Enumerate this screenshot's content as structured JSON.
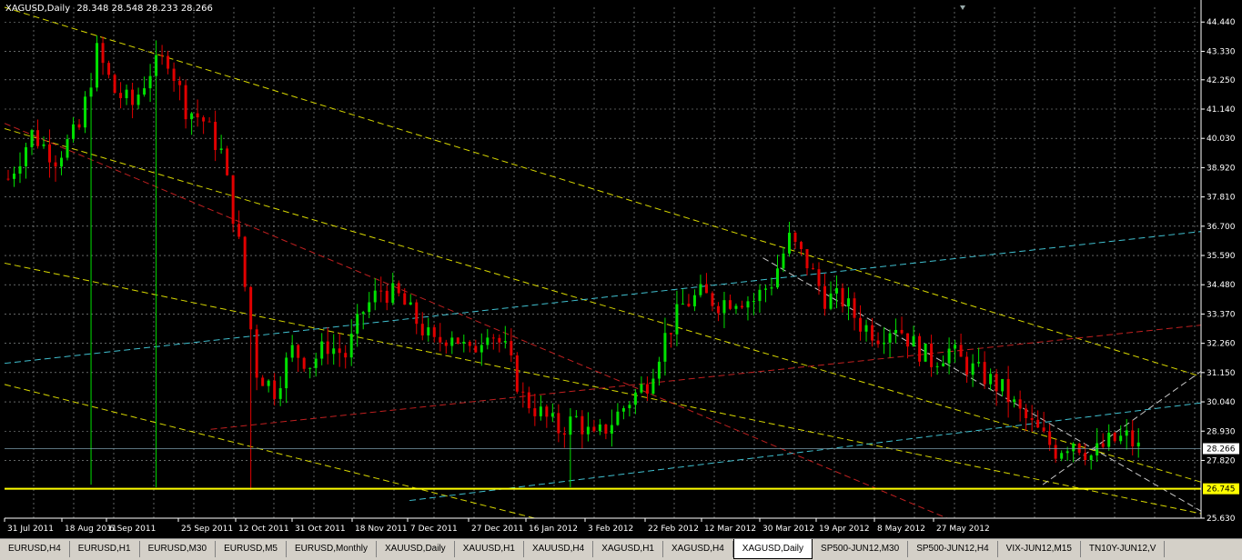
{
  "window": {
    "title_symbol": "XAGUSD,Daily",
    "ohlc": "28.348 28.548 28.233 28.266"
  },
  "colors": {
    "bull": "#00e000",
    "bear": "#e00000",
    "grid": "#9ea4a4",
    "trend_yellow": "#d8d800",
    "trend_cyan": "#40c0d0",
    "trend_red": "#c02020",
    "trend_white": "#c8c8c8",
    "hline": "#ffff00"
  },
  "chart_data": {
    "type": "candlestick",
    "symbol": "XAGUSD",
    "timeframe": "Daily",
    "ylim": [
      25.63,
      45.0
    ],
    "y_ticks": [
      "44.440",
      "43.330",
      "42.250",
      "41.140",
      "40.030",
      "38.920",
      "37.810",
      "36.700",
      "35.590",
      "34.480",
      "33.370",
      "32.260",
      "31.150",
      "30.040",
      "28.930",
      "27.820",
      "26.745",
      "25.630"
    ],
    "x_ticks": [
      "31 Jul 2011",
      "18 Aug 2011",
      "6 Sep 2011",
      "25 Sep 2011",
      "12 Oct 2011",
      "31 Oct 2011",
      "18 Nov 2011",
      "7 Dec 2011",
      "27 Dec 2011",
      "16 Jan 2012",
      "3 Feb 2012",
      "22 Feb 2012",
      "12 Mar 2012",
      "30 Mar 2012",
      "19 Apr 2012",
      "8 May 2012",
      "27 May 2012"
    ],
    "current_price": "28.266",
    "hline_price": "26.745",
    "grid": true,
    "price_path": [
      [
        0,
        38.5
      ],
      [
        4,
        40.2
      ],
      [
        8,
        39.3
      ],
      [
        12,
        40.4
      ],
      [
        15,
        43.3
      ],
      [
        18,
        41.8
      ],
      [
        21,
        41.3
      ],
      [
        24,
        42.6
      ],
      [
        27,
        43.1
      ],
      [
        30,
        41.2
      ],
      [
        33,
        40.7
      ],
      [
        36,
        39.5
      ],
      [
        39,
        36.0
      ],
      [
        42,
        31.2
      ],
      [
        45,
        30.5
      ],
      [
        48,
        32.0
      ],
      [
        51,
        31.5
      ],
      [
        54,
        32.2
      ],
      [
        57,
        31.8
      ],
      [
        60,
        33.5
      ],
      [
        63,
        34.3
      ],
      [
        66,
        34.0
      ],
      [
        69,
        33.1
      ],
      [
        72,
        32.2
      ],
      [
        75,
        32.7
      ],
      [
        78,
        31.8
      ],
      [
        81,
        32.9
      ],
      [
        84,
        32.0
      ],
      [
        87,
        30.2
      ],
      [
        90,
        29.6
      ],
      [
        93,
        29.0
      ],
      [
        96,
        29.4
      ],
      [
        99,
        28.6
      ],
      [
        102,
        29.3
      ],
      [
        105,
        30.1
      ],
      [
        108,
        30.8
      ],
      [
        111,
        32.5
      ],
      [
        114,
        33.7
      ],
      [
        117,
        34.1
      ],
      [
        120,
        33.8
      ],
      [
        123,
        34.0
      ],
      [
        126,
        33.9
      ],
      [
        129,
        34.6
      ],
      [
        132,
        36.2
      ],
      [
        135,
        35.3
      ],
      [
        138,
        34.0
      ],
      [
        141,
        33.9
      ],
      [
        144,
        33.0
      ],
      [
        147,
        32.6
      ],
      [
        150,
        33.0
      ],
      [
        153,
        32.2
      ],
      [
        156,
        31.6
      ],
      [
        159,
        32.0
      ],
      [
        162,
        31.4
      ],
      [
        165,
        31.0
      ],
      [
        168,
        30.5
      ],
      [
        171,
        29.6
      ],
      [
        174,
        28.9
      ],
      [
        177,
        28.2
      ],
      [
        180,
        28.6
      ],
      [
        183,
        28.0
      ],
      [
        186,
        28.5
      ],
      [
        189,
        28.7
      ],
      [
        191,
        28.27
      ]
    ],
    "spikes": [
      {
        "i": 14,
        "value": 26.9
      },
      {
        "i": 25,
        "value": 26.8
      },
      {
        "i": 41,
        "value": 26.7
      },
      {
        "i": 95,
        "value": 26.8
      }
    ],
    "trendlines": [
      {
        "color": "yellow",
        "p1": [
          "2011-07-31",
          45.0
        ],
        "p2": [
          "2012-06-20",
          31.0
        ]
      },
      {
        "color": "yellow",
        "p1": [
          "2011-07-31",
          40.4
        ],
        "p2": [
          "2012-06-20",
          27.0
        ]
      },
      {
        "color": "yellow",
        "p1": [
          "2011-07-31",
          35.3
        ],
        "p2": [
          "2012-06-20",
          25.8
        ]
      },
      {
        "color": "yellow",
        "p1": [
          "2011-07-31",
          30.7
        ],
        "p2": [
          "2011-12-22",
          25.63
        ]
      },
      {
        "color": "red",
        "p1": [
          "2011-07-31",
          40.6
        ],
        "p2": [
          "2012-04-12",
          25.63
        ]
      },
      {
        "color": "red",
        "p1": [
          "2011-09-25",
          29.0
        ],
        "p2": [
          "2012-06-20",
          32.95
        ]
      },
      {
        "color": "cyan",
        "p1": [
          "2011-07-31",
          31.5
        ],
        "p2": [
          "2012-06-20",
          36.5
        ]
      },
      {
        "color": "cyan",
        "p1": [
          "2011-11-18",
          26.3
        ],
        "p2": [
          "2012-06-20",
          30.0
        ]
      },
      {
        "color": "white",
        "p1": [
          "2012-02-22",
          35.5
        ],
        "p2": [
          "2012-06-20",
          25.9
        ]
      },
      {
        "color": "white",
        "p1": [
          "2012-05-08",
          26.9
        ],
        "p2": [
          "2012-06-20",
          31.2
        ]
      }
    ]
  },
  "tabs": [
    {
      "label": "EURUSD,H4",
      "active": false
    },
    {
      "label": "EURUSD,H1",
      "active": false
    },
    {
      "label": "EURUSD,M30",
      "active": false
    },
    {
      "label": "EURUSD,M5",
      "active": false
    },
    {
      "label": "EURUSD,Monthly",
      "active": false
    },
    {
      "label": "XAUUSD,Daily",
      "active": false
    },
    {
      "label": "XAUUSD,H1",
      "active": false
    },
    {
      "label": "XAUUSD,H4",
      "active": false
    },
    {
      "label": "XAGUSD,H1",
      "active": false
    },
    {
      "label": "XAGUSD,H4",
      "active": false
    },
    {
      "label": "XAGUSD,Daily",
      "active": true
    },
    {
      "label": "SP500-JUN12,M30",
      "active": false
    },
    {
      "label": "SP500-JUN12,H4",
      "active": false
    },
    {
      "label": "VIX-JUN12,M15",
      "active": false
    },
    {
      "label": "TN10Y-JUN12,V",
      "active": false
    }
  ]
}
